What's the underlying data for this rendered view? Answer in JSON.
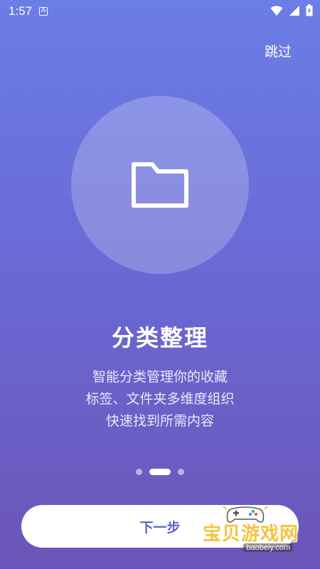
{
  "status_bar": {
    "time": "1:57",
    "notification_icon": "A"
  },
  "skip_label": "跳过",
  "illustration_icon": "folder-icon",
  "title": "分类整理",
  "description_lines": [
    "智能分类管理你的收藏",
    "标签、文件夹多维度组织",
    "快速找到所需内容"
  ],
  "pager": {
    "total": 3,
    "active_index": 1
  },
  "next_button_label": "下一步",
  "watermark": {
    "text": "宝贝游戏网",
    "url": "baobeiy.com"
  },
  "colors": {
    "gradient_top": "#6b7ee6",
    "gradient_bottom": "#6c55b8",
    "button_text": "#5d63c9",
    "watermark_text": "#f7c23c"
  }
}
